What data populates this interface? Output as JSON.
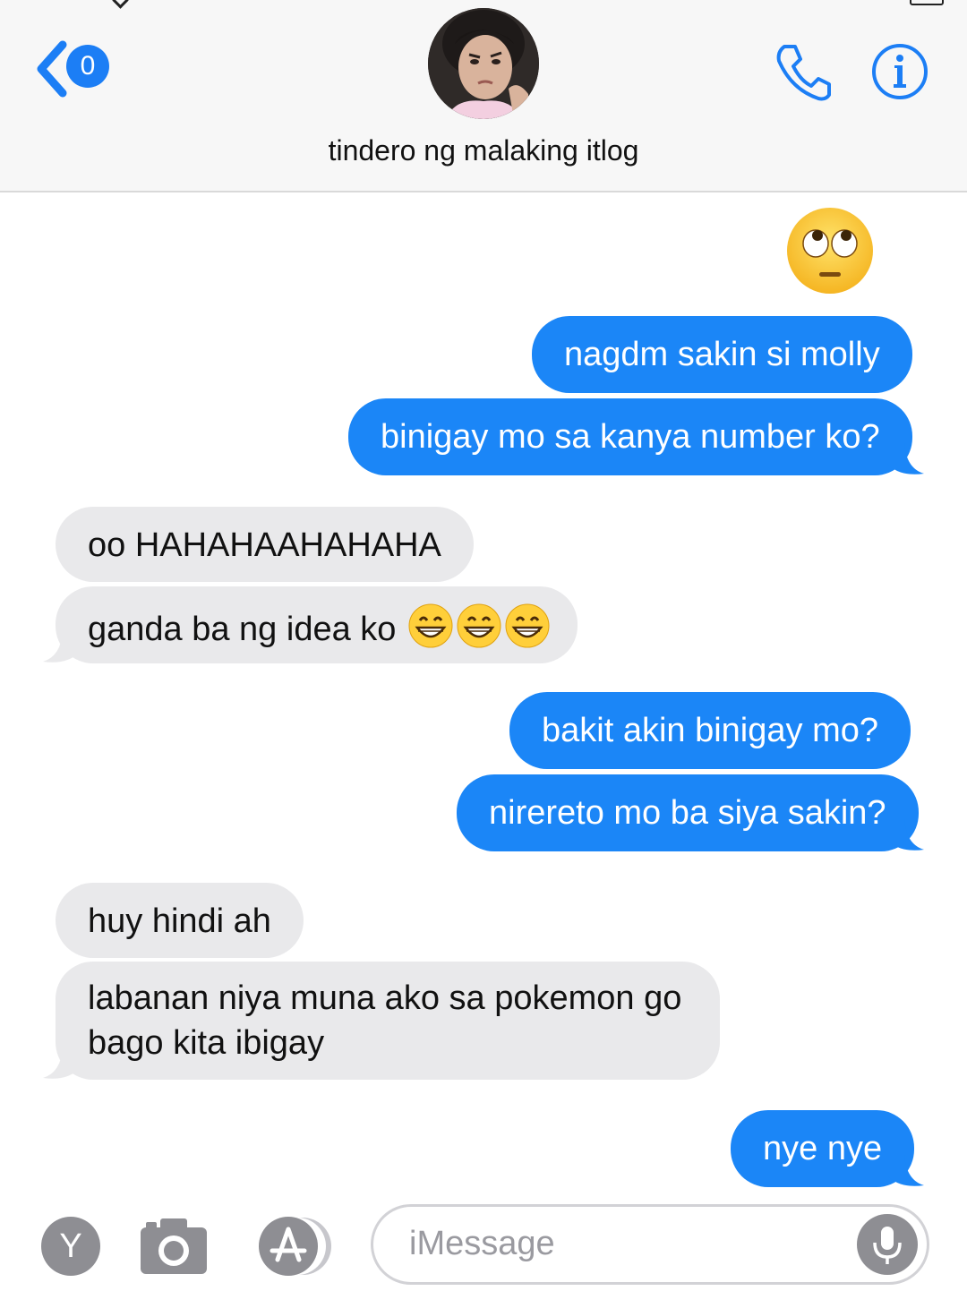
{
  "header": {
    "back_count": "0",
    "contact_name": "tindero ng malaking itlog"
  },
  "icons": {
    "back": "chevron-left-icon",
    "call": "phone-icon",
    "info": "info-icon",
    "camera": "camera-icon",
    "appstore": "app-store-icon",
    "mic": "microphone-icon"
  },
  "colors": {
    "accent": "#1c7ef5",
    "sent_bubble": "#1b86f7",
    "received_bubble": "#e9e9eb"
  },
  "messages": [
    {
      "from": "me",
      "type": "emoji",
      "emoji": "face-with-rolling-eyes"
    },
    {
      "from": "me",
      "text": "nagdm sakin si molly"
    },
    {
      "from": "me",
      "text": "binigay mo sa kanya number ko?"
    },
    {
      "from": "them",
      "text": "oo HAHAHAAHAHAHA"
    },
    {
      "from": "them",
      "text": "ganda ba ng idea ko",
      "emojis": [
        "grinning-face-with-smiling-eyes",
        "grinning-face-with-smiling-eyes",
        "grinning-face-with-smiling-eyes"
      ]
    },
    {
      "from": "me",
      "text": "bakit akin binigay mo?"
    },
    {
      "from": "me",
      "text": "nirereto mo ba siya sakin?"
    },
    {
      "from": "them",
      "text": "huy hindi ah"
    },
    {
      "from": "them",
      "text_line1": "labanan niya muna ako sa pokemon go",
      "text_line2": "bago kita ibigay"
    },
    {
      "from": "me",
      "text": "nye nye"
    }
  ],
  "composer": {
    "y_button": "Y",
    "placeholder": "iMessage"
  }
}
